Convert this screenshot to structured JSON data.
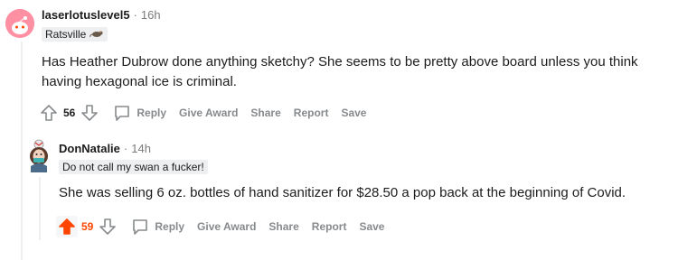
{
  "comments": [
    {
      "author": "laserlotuslevel5",
      "separator": "·",
      "time": "16h",
      "flair": "Ratsville",
      "body": "Has Heather Dubrow done anything sketchy? She seems to be pretty above board unless you think having hexagonal ice is criminal.",
      "score": "56",
      "upvoted": false,
      "actions": {
        "reply": "Reply",
        "award": "Give Award",
        "share": "Share",
        "report": "Report",
        "save": "Save"
      }
    },
    {
      "author": "DonNatalie",
      "separator": "·",
      "time": "14h",
      "flair": "Do not call my swan a fucker!",
      "body": "She was selling 6 oz. bottles of hand sanitizer for $28.50 a pop back at the beginning of Covid.",
      "score": "59",
      "upvoted": true,
      "actions": {
        "reply": "Reply",
        "award": "Give Award",
        "share": "Share",
        "report": "Report",
        "save": "Save"
      }
    }
  ],
  "colors": {
    "upvote": "#ff4500",
    "muted": "#878a8c",
    "thread": "#edeff1",
    "avatar_bg": "#ff8fa3"
  }
}
